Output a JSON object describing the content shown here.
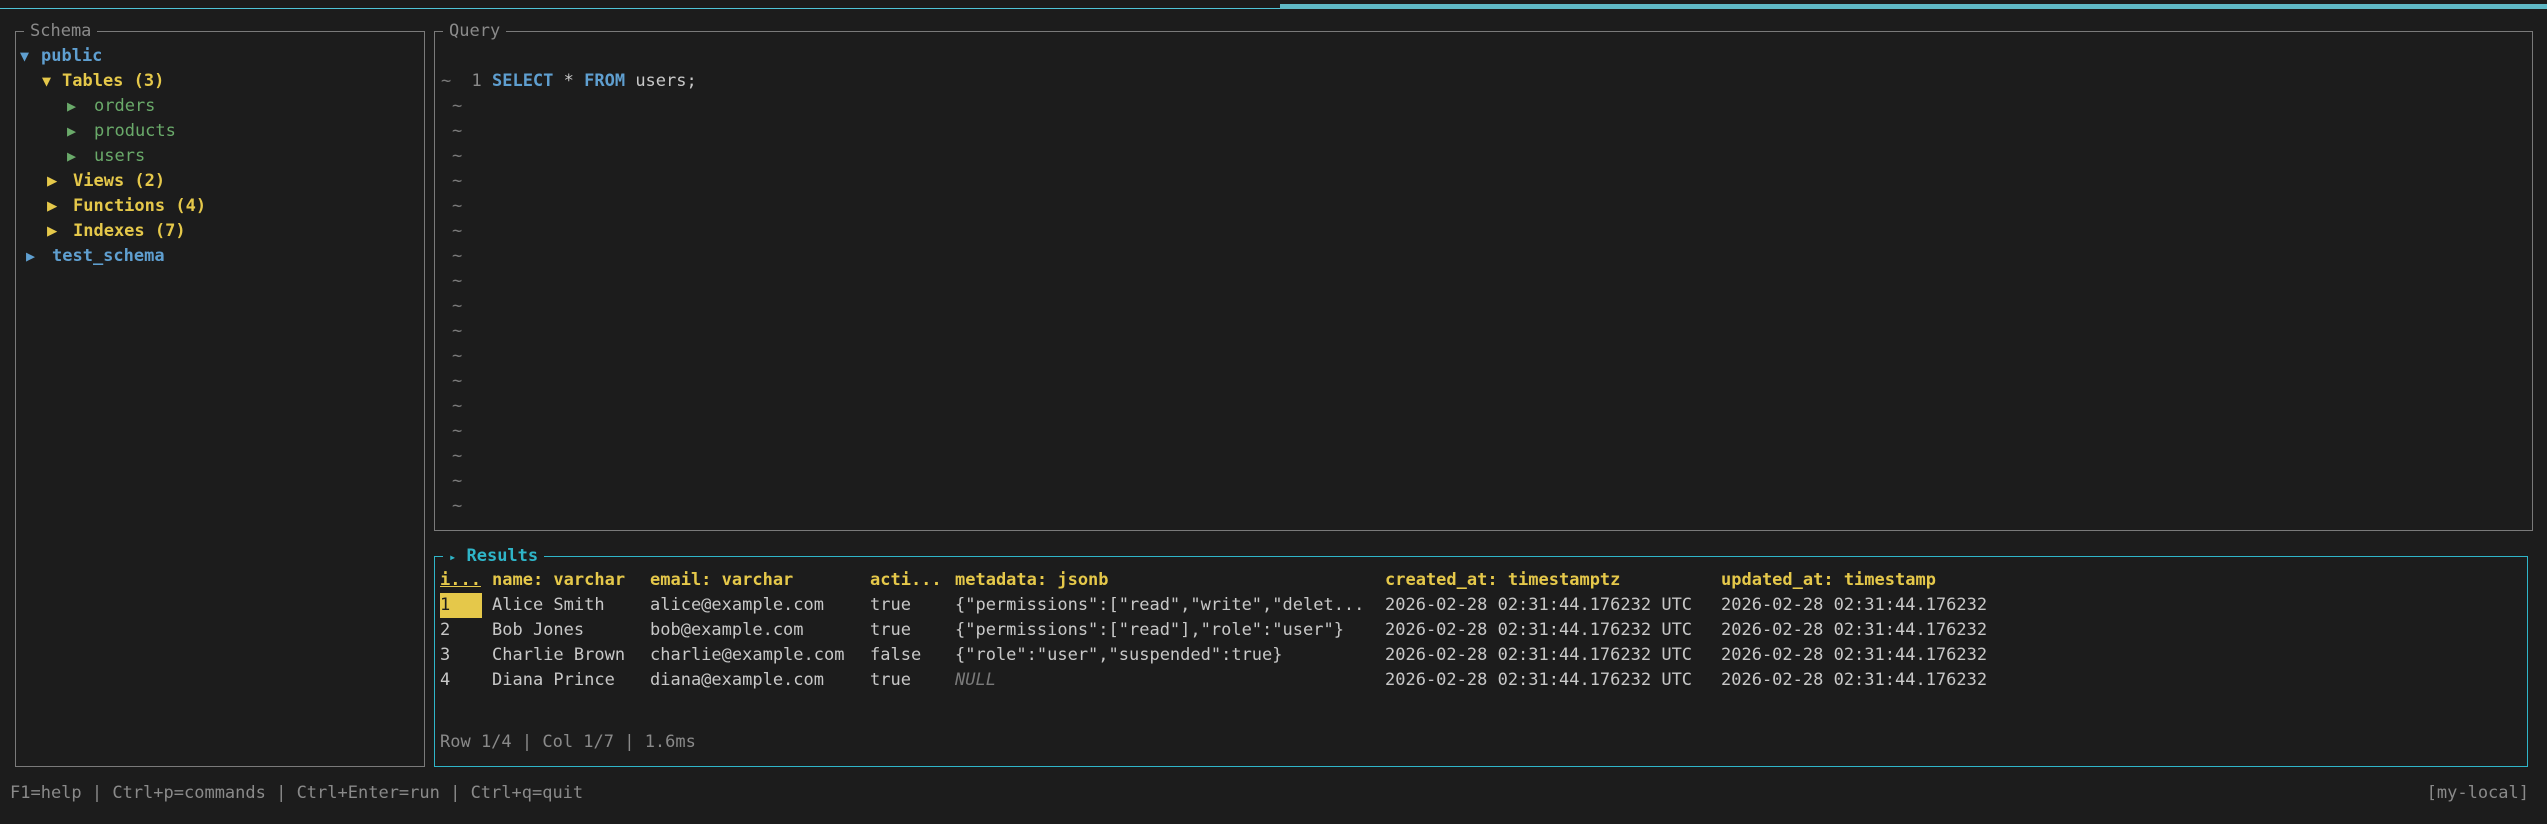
{
  "schema": {
    "title": "Schema",
    "tree": [
      {
        "arrow": "▼",
        "label": "public",
        "kind": "schema"
      },
      {
        "arrow": "▼",
        "label": "Tables (3)",
        "kind": "group"
      },
      {
        "arrow": "▶",
        "label": "orders",
        "kind": "table"
      },
      {
        "arrow": "▶",
        "label": "products",
        "kind": "table"
      },
      {
        "arrow": "▶",
        "label": "users",
        "kind": "table"
      },
      {
        "arrow": "▶",
        "label": "Views (2)",
        "kind": "group"
      },
      {
        "arrow": "▶",
        "label": "Functions (4)",
        "kind": "group"
      },
      {
        "arrow": "▶",
        "label": "Indexes (7)",
        "kind": "group"
      },
      {
        "arrow": "▶",
        "label": "test_schema",
        "kind": "schema"
      }
    ]
  },
  "query": {
    "title": "Query",
    "line_number": "1",
    "tokens": {
      "k1": "SELECT",
      "star": " * ",
      "k2": "FROM",
      "rest": " users;"
    },
    "empty_line_marker": "~"
  },
  "results": {
    "title": "Results",
    "title_icon": "▸",
    "columns": [
      "i...",
      "name: varchar",
      "email: varchar",
      "acti...",
      "metadata: jsonb",
      "created_at: timestamptz",
      "updated_at: timestamp"
    ],
    "rows": [
      [
        "1",
        "Alice Smith",
        "alice@example.com",
        "true",
        "{\"permissions\":[\"read\",\"write\",\"delet...",
        "2026-02-28 02:31:44.176232 UTC",
        "2026-02-28 02:31:44.176232"
      ],
      [
        "2",
        "Bob Jones",
        "bob@example.com",
        "true",
        "{\"permissions\":[\"read\"],\"role\":\"user\"}",
        "2026-02-28 02:31:44.176232 UTC",
        "2026-02-28 02:31:44.176232"
      ],
      [
        "3",
        "Charlie Brown",
        "charlie@example.com",
        "false",
        "{\"role\":\"user\",\"suspended\":true}",
        "2026-02-28 02:31:44.176232 UTC",
        "2026-02-28 02:31:44.176232"
      ],
      [
        "4",
        "Diana Prince",
        "diana@example.com",
        "true",
        "NULL",
        "2026-02-28 02:31:44.176232 UTC",
        "2026-02-28 02:31:44.176232"
      ]
    ],
    "status": "Row 1/4 | Col 1/7 | 1.6ms"
  },
  "statusbar": {
    "hints": "F1=help | Ctrl+p=commands | Ctrl+Enter=run | Ctrl+q=quit",
    "connection": "[my-local]"
  },
  "colors": {
    "background": "#1c1c1c",
    "accent": "#2fb5c8",
    "header": "#e5c84a",
    "keyword": "#5f9fd0",
    "table": "#6aaa6a"
  }
}
